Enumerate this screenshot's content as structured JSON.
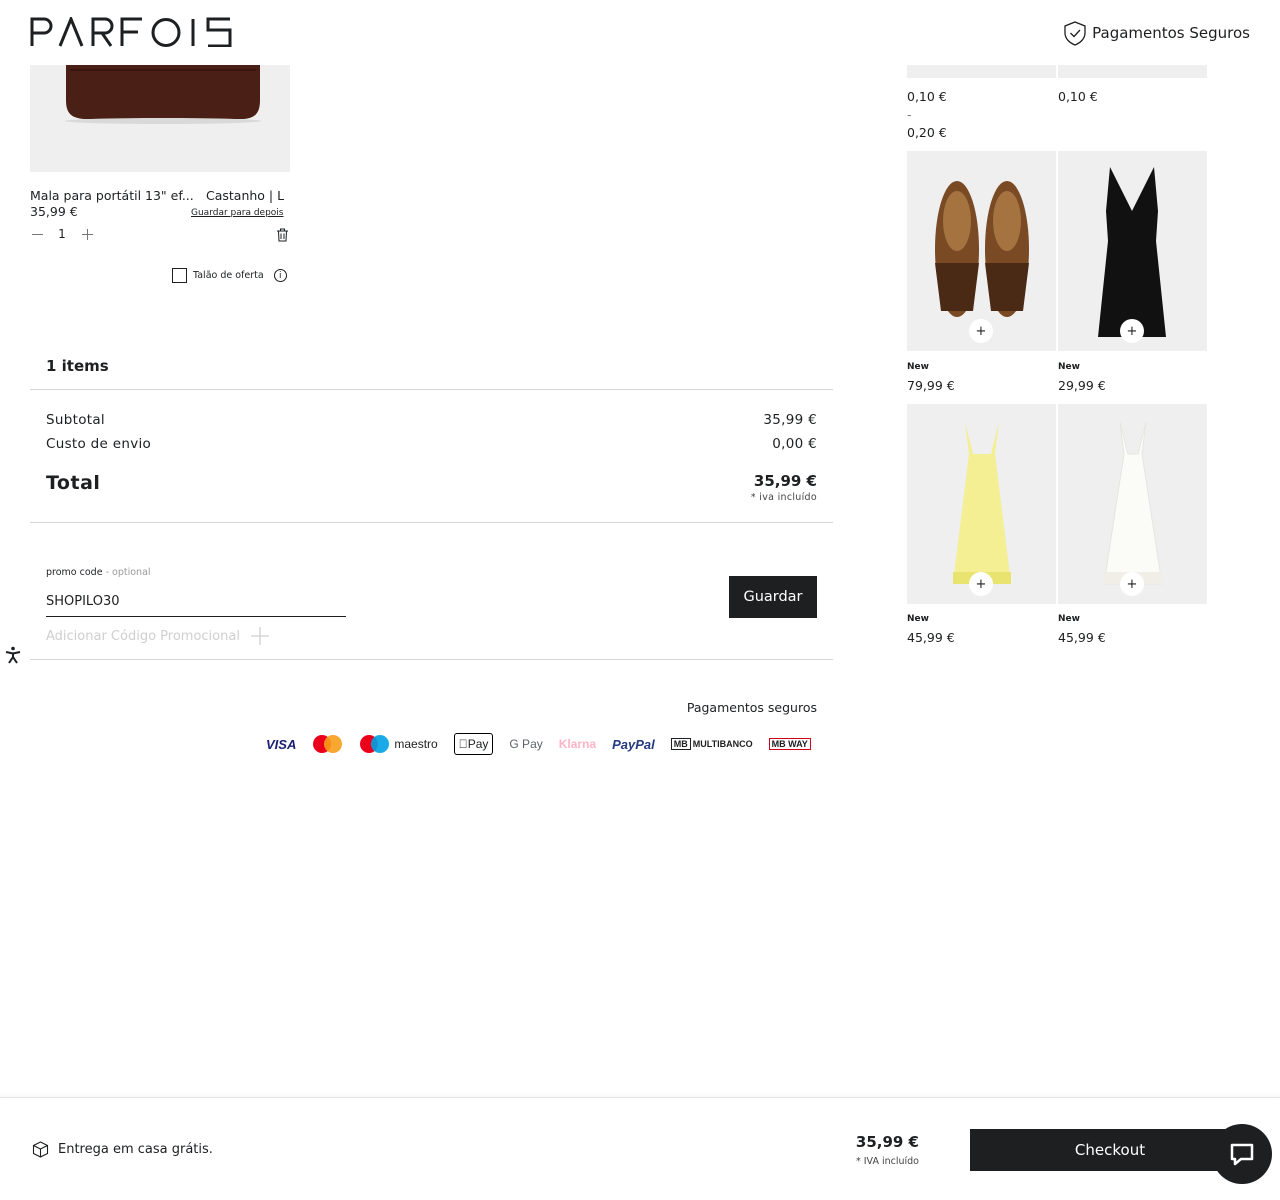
{
  "header": {
    "brand": "PARFOIS",
    "secure_label": "Pagamentos Seguros"
  },
  "cart_item": {
    "name": "Mala para portátil 13\" ef...",
    "variant": "Castanho | L",
    "price": "35,99 €",
    "save_later": "Guardar para depois",
    "quantity": "1",
    "gift_receipt": "Talão de oferta",
    "image_icon": "brown-laptop-bag",
    "image_color": "#4a1f15"
  },
  "summary": {
    "items_count": "1 items",
    "subtotal_label": "Subtotal",
    "subtotal_value": "35,99 €",
    "shipping_label": "Custo de envio",
    "shipping_value": "0,00 €",
    "total_label": "Total",
    "total_value": "35,99 €",
    "iva_note": "* iva incluído"
  },
  "promo": {
    "label": "promo code",
    "optional": "- optional",
    "value": "SHOPILO30",
    "save_button": "Guardar",
    "add_label": "Adicionar Código Promocional"
  },
  "payments": {
    "title": "Pagamentos seguros",
    "methods": [
      "VISA",
      "Mastercard",
      "maestro",
      "Pay",
      "G Pay",
      "Klarna",
      "PayPal",
      "MULTIBANCO",
      "MB WAY"
    ]
  },
  "recommendations": {
    "top_prices": [
      {
        "price_from": "0,10 €",
        "sep": "-",
        "price_to": "0,20 €"
      },
      {
        "price_from": "0,10 €"
      }
    ],
    "products": [
      {
        "badge": "New",
        "price": "79,99 €",
        "image": "brown-fringe-loafers"
      },
      {
        "badge": "New",
        "price": "29,99 €",
        "image": "black-midi-dress"
      },
      {
        "badge": "New",
        "price": "45,99 €",
        "image": "yellow-halter-dress"
      },
      {
        "badge": "New",
        "price": "45,99 €",
        "image": "white-halter-dress"
      }
    ],
    "add_symbol": "+"
  },
  "footer": {
    "delivery": "Entrega em casa grátis.",
    "total": "35,99 €",
    "iva_note": "* IVA incluído",
    "checkout": "Checkout"
  },
  "colors": {
    "accent": "#1d1f21",
    "image_bg": "#efefef",
    "muted": "#cfcfcf"
  }
}
